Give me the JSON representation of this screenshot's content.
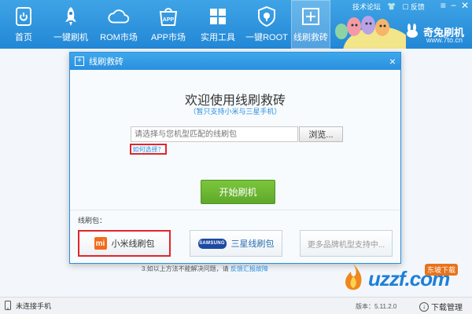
{
  "nav": {
    "items": [
      {
        "label": "首页",
        "icon": "home-icon"
      },
      {
        "label": "一键刷机",
        "icon": "rocket-icon"
      },
      {
        "label": "ROM市场",
        "icon": "cloud-icon"
      },
      {
        "label": "APP市场",
        "icon": "app-bag-icon"
      },
      {
        "label": "实用工具",
        "icon": "grid-icon"
      },
      {
        "label": "一键ROOT",
        "icon": "shield-icon"
      },
      {
        "label": "线刷救砖",
        "icon": "cross-box-icon"
      }
    ],
    "active_index": 6
  },
  "top_links": {
    "forum": "技术论坛",
    "feedback": "反馈"
  },
  "brand": {
    "name": "奇兔刷机",
    "url": "www.7to.cn"
  },
  "dialog": {
    "title": "线刷救砖",
    "welcome": "欢迎使用线刷救砖",
    "subtitle": "（暂只支持小米与三星手机）",
    "input_placeholder": "请选择与您机型匹配的线刷包",
    "browse_label": "浏览...",
    "howto_link": "如何选择？",
    "start_label": "开始刷机",
    "package_label": "线刷包：",
    "packages": {
      "xiaomi": "小米线刷包",
      "samsung": "三星线刷包",
      "more": "更多品牌机型支持中..."
    },
    "xiaomi_logo": "mi",
    "samsung_logo": "SAMSUNG"
  },
  "behind_note": {
    "text": "3.如以上方法不能解决问题，请",
    "link": "反馈汇报故障"
  },
  "status": {
    "connection": "未连接手机",
    "version": "版本：5.11.2.0",
    "download_label": "下载管理"
  },
  "watermark": {
    "text": "uzzf.com",
    "badge": "东坡下载"
  },
  "colors": {
    "toolbar": "#2287d6",
    "accent_blue": "#2a8fe0",
    "start_green": "#6bb534",
    "highlight_red": "#e0262d"
  }
}
